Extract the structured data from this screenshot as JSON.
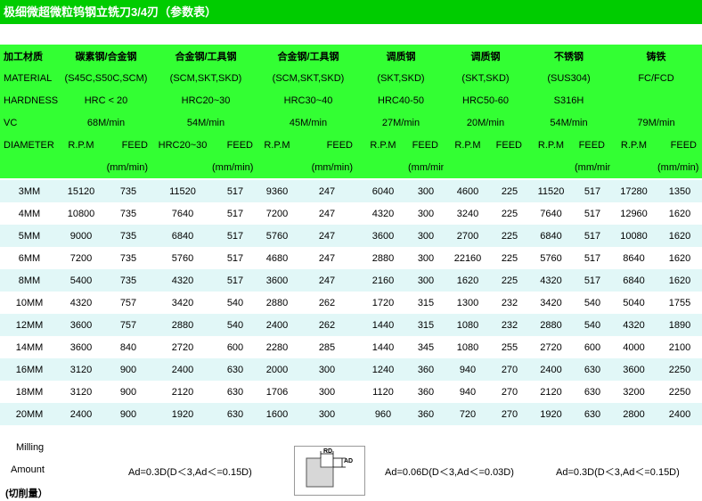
{
  "title": "极细微超微粒钨钢立铣刀3/4刃（参数表）",
  "header_rows": [
    [
      {
        "text": "加工材质",
        "col": 0,
        "span": 1
      },
      {
        "text": "碳素钢/合金钢",
        "col": 1,
        "span": 2
      },
      {
        "text": "合金钢/工具钢",
        "col": 3,
        "span": 2
      },
      {
        "text": "合金钢/工具钢",
        "col": 5,
        "span": 2
      },
      {
        "text": "调质钢",
        "col": 7,
        "span": 2
      },
      {
        "text": "调质钢",
        "col": 9,
        "span": 2
      },
      {
        "text": "不锈钢",
        "col": 11,
        "span": 2
      },
      {
        "text": "铸铁",
        "col": 13,
        "span": 2
      }
    ],
    [
      {
        "text": "MATERIAL",
        "col": 0,
        "span": 1
      },
      {
        "text": "(S45C,S50C,SCM)",
        "col": 1,
        "span": 2
      },
      {
        "text": "(SCM,SKT,SKD)",
        "col": 3,
        "span": 2
      },
      {
        "text": "(SCM,SKT,SKD)",
        "col": 5,
        "span": 2
      },
      {
        "text": "(SKT,SKD)",
        "col": 7,
        "span": 2
      },
      {
        "text": "(SKT,SKD)",
        "col": 9,
        "span": 2
      },
      {
        "text": "(SUS304)",
        "col": 11,
        "span": 2
      },
      {
        "text": "FC/FCD",
        "col": 13,
        "span": 2
      }
    ],
    [
      {
        "text": "HARDNESS",
        "col": 0,
        "span": 1
      },
      {
        "text": "HRC < 20",
        "col": 1,
        "span": 2
      },
      {
        "text": "HRC20~30",
        "col": 3,
        "span": 2
      },
      {
        "text": "HRC30~40",
        "col": 5,
        "span": 2
      },
      {
        "text": "HRC40-50",
        "col": 7,
        "span": 2
      },
      {
        "text": "HRC50-60",
        "col": 9,
        "span": 2
      },
      {
        "text": "S316H",
        "col": 11,
        "span": 2
      },
      {
        "text": "",
        "col": 13,
        "span": 2
      }
    ],
    [
      {
        "text": "VC",
        "col": 0,
        "span": 1
      },
      {
        "text": "68M/min",
        "col": 1,
        "span": 2
      },
      {
        "text": "54M/min",
        "col": 3,
        "span": 2
      },
      {
        "text": "45M/min",
        "col": 5,
        "span": 2
      },
      {
        "text": "27M/min",
        "col": 7,
        "span": 2
      },
      {
        "text": "20M/min",
        "col": 9,
        "span": 2
      },
      {
        "text": "54M/min",
        "col": 11,
        "span": 2
      },
      {
        "text": "79M/min",
        "col": 13,
        "span": 2
      }
    ],
    [
      {
        "text": "DIAMETER",
        "col": 0,
        "span": 1
      },
      {
        "text": "R.P.M",
        "col": 1,
        "span": 1
      },
      {
        "text": "FEED",
        "col": 2,
        "span": 1
      },
      {
        "text": "HRC20~30",
        "col": 3,
        "span": 1
      },
      {
        "text": "FEED",
        "col": 4,
        "span": 1
      },
      {
        "text": "R.P.M",
        "col": 5,
        "span": 1
      },
      {
        "text": "FEED",
        "col": 6,
        "span": 1
      },
      {
        "text": "R.P.M",
        "col": 7,
        "span": 1
      },
      {
        "text": "FEED",
        "col": 8,
        "span": 1
      },
      {
        "text": "R.P.M",
        "col": 9,
        "span": 1
      },
      {
        "text": "FEED",
        "col": 10,
        "span": 1
      },
      {
        "text": "R.P.M",
        "col": 11,
        "span": 1
      },
      {
        "text": "FEED",
        "col": 12,
        "span": 1
      },
      {
        "text": "R.P.M",
        "col": 13,
        "span": 1
      },
      {
        "text": "FEED",
        "col": 14,
        "span": 1
      }
    ],
    [
      {
        "text": "",
        "col": 0,
        "span": 1
      },
      {
        "text": "",
        "col": 1,
        "span": 1
      },
      {
        "text": "(mm/min)",
        "col": 2,
        "span": 1
      },
      {
        "text": "",
        "col": 3,
        "span": 1
      },
      {
        "text": "(mm/min)",
        "col": 4,
        "span": 1
      },
      {
        "text": "",
        "col": 5,
        "span": 1
      },
      {
        "text": "(mm/min)",
        "col": 6,
        "span": 1
      },
      {
        "text": "",
        "col": 7,
        "span": 1
      },
      {
        "text": "(mm/min)",
        "col": 8,
        "span": 1
      },
      {
        "text": "",
        "col": 9,
        "span": 1
      },
      {
        "text": "",
        "col": 10,
        "span": 1
      },
      {
        "text": "",
        "col": 11,
        "span": 1
      },
      {
        "text": "(mm/min)",
        "col": 12,
        "span": 1
      },
      {
        "text": "",
        "col": 13,
        "span": 1
      },
      {
        "text": "(mm/min)",
        "col": 14,
        "span": 1
      }
    ]
  ],
  "rows": [
    [
      "3MM",
      "15120",
      "735",
      "11520",
      "517",
      "9360",
      "247",
      "6040",
      "300",
      "4600",
      "225",
      "11520",
      "517",
      "17280",
      "1350"
    ],
    [
      "4MM",
      "10800",
      "735",
      "7640",
      "517",
      "7200",
      "247",
      "4320",
      "300",
      "3240",
      "225",
      "7640",
      "517",
      "12960",
      "1620"
    ],
    [
      "5MM",
      "9000",
      "735",
      "6840",
      "517",
      "5760",
      "247",
      "3600",
      "300",
      "2700",
      "225",
      "6840",
      "517",
      "10080",
      "1620"
    ],
    [
      "6MM",
      "7200",
      "735",
      "5760",
      "517",
      "4680",
      "247",
      "2880",
      "300",
      "22160",
      "225",
      "5760",
      "517",
      "8640",
      "1620"
    ],
    [
      "8MM",
      "5400",
      "735",
      "4320",
      "517",
      "3600",
      "247",
      "2160",
      "300",
      "1620",
      "225",
      "4320",
      "517",
      "6840",
      "1620"
    ],
    [
      "10MM",
      "4320",
      "757",
      "3420",
      "540",
      "2880",
      "262",
      "1720",
      "315",
      "1300",
      "232",
      "3420",
      "540",
      "5040",
      "1755"
    ],
    [
      "12MM",
      "3600",
      "757",
      "2880",
      "540",
      "2400",
      "262",
      "1440",
      "315",
      "1080",
      "232",
      "2880",
      "540",
      "4320",
      "1890"
    ],
    [
      "14MM",
      "3600",
      "840",
      "2720",
      "600",
      "2280",
      "285",
      "1440",
      "345",
      "1080",
      "255",
      "2720",
      "600",
      "4000",
      "2100"
    ],
    [
      "16MM",
      "3120",
      "900",
      "2400",
      "630",
      "2000",
      "300",
      "1240",
      "360",
      "940",
      "270",
      "2400",
      "630",
      "3600",
      "2250"
    ],
    [
      "18MM",
      "3120",
      "900",
      "2120",
      "630",
      "1706",
      "300",
      "1120",
      "360",
      "940",
      "270",
      "2120",
      "630",
      "3200",
      "2250"
    ],
    [
      "20MM",
      "2400",
      "900",
      "1920",
      "630",
      "1600",
      "300",
      "960",
      "360",
      "720",
      "270",
      "1920",
      "630",
      "2800",
      "2400"
    ]
  ],
  "footer": {
    "label_line1": "Milling",
    "label_line2": "Amount",
    "label_line3": "(切削量）",
    "formula1": "Ad=0.3D(D＜3,Ad＜=0.15D)",
    "formula2": "Ad=0.06D(D＜3,Ad＜=0.03D)",
    "formula3": "Ad=0.3D(D＜3,Ad＜=0.15D)",
    "diagram_rd": "RD",
    "diagram_ad": "AD"
  },
  "colors": {
    "title_bg": "#00CC00",
    "header_bg": "#33FF33",
    "row_alt_bg": "#E1F7F7"
  }
}
